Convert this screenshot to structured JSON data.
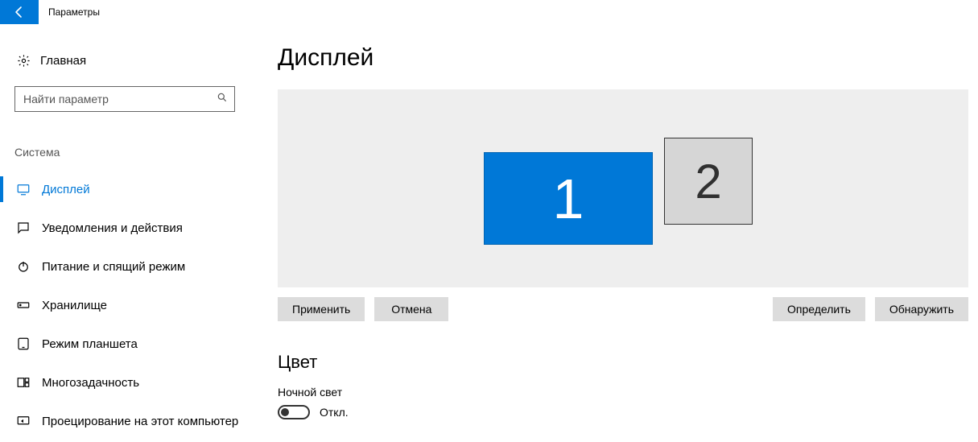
{
  "titlebar": {
    "title": "Параметры"
  },
  "sidebar": {
    "home": "Главная",
    "search_placeholder": "Найти параметр",
    "category": "Система",
    "items": [
      {
        "label": "Дисплей"
      },
      {
        "label": "Уведомления и действия"
      },
      {
        "label": "Питание и спящий режим"
      },
      {
        "label": "Хранилище"
      },
      {
        "label": "Режим планшета"
      },
      {
        "label": "Многозадачность"
      },
      {
        "label": "Проецирование на этот компьютер"
      }
    ]
  },
  "main": {
    "title": "Дисплей",
    "monitors": {
      "primary": "1",
      "secondary": "2"
    },
    "buttons": {
      "apply": "Применить",
      "cancel": "Отмена",
      "identify": "Определить",
      "detect": "Обнаружить"
    },
    "color_section": "Цвет",
    "night_light_label": "Ночной свет",
    "toggle_state": "Откл."
  }
}
